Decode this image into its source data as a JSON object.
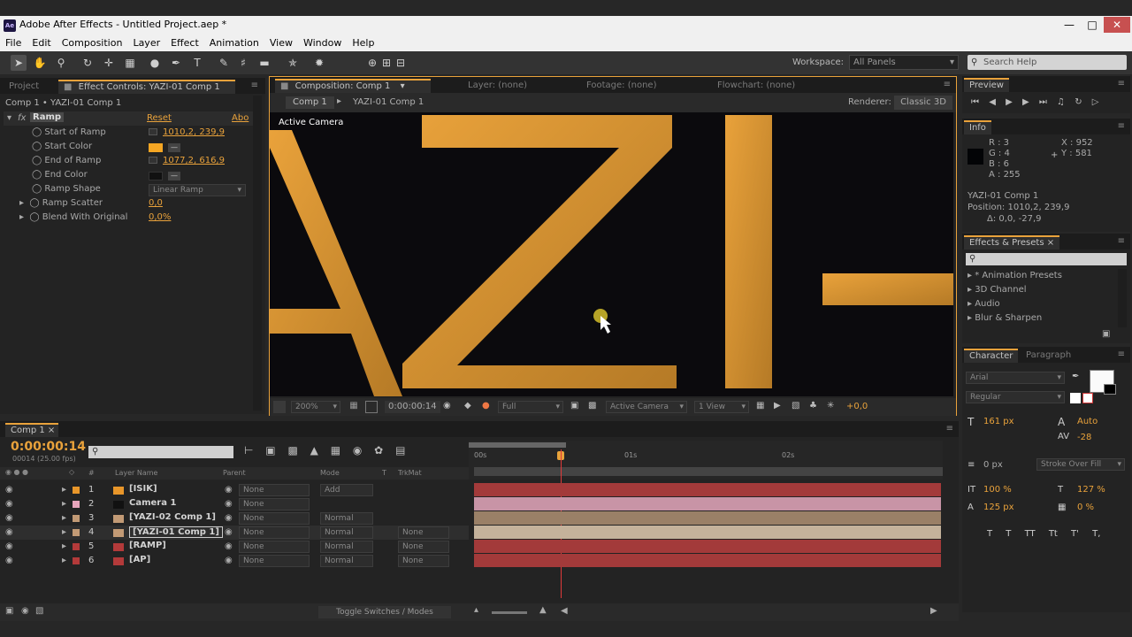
{
  "window": {
    "title": "Adobe After Effects - Untitled Project.aep *",
    "logo": "Ae"
  },
  "menu": [
    "File",
    "Edit",
    "Composition",
    "Layer",
    "Effect",
    "Animation",
    "View",
    "Window",
    "Help"
  ],
  "toolbar": {
    "workspace_label": "Workspace:",
    "workspace_value": "All Panels",
    "search_placeholder": "Search Help"
  },
  "project_panel": {
    "tab_project": "Project",
    "tab_effect": "Effect Controls: YAZI-01 Comp 1",
    "breadcrumb": "Comp 1 • YAZI-01 Comp 1",
    "effect_name": "Ramp",
    "reset": "Reset",
    "about": "Abo",
    "props": [
      {
        "name": "Start of Ramp",
        "value": "1010,2, 239,9"
      },
      {
        "name": "Start Color",
        "value": ""
      },
      {
        "name": "End of Ramp",
        "value": "1077,2, 616,9"
      },
      {
        "name": "End Color",
        "value": ""
      },
      {
        "name": "Ramp Shape",
        "value": "Linear Ramp"
      },
      {
        "name": "Ramp Scatter",
        "value": "0,0"
      },
      {
        "name": "Blend With Original",
        "value": "0,0%"
      }
    ],
    "start_color": "#f5a623",
    "end_color": "#111111"
  },
  "comp_panel": {
    "tab_comp": "Composition: Comp 1",
    "tab_layer": "Layer: (none)",
    "tab_footage": "Footage: (none)",
    "tab_flowchart": "Flowchart: (none)",
    "comp_name": "Comp 1",
    "sub_comp": "YAZI-01 Comp 1",
    "renderer_label": "Renderer:",
    "renderer_value": "Classic 3D",
    "active_camera": "Active Camera",
    "zoom": "200%",
    "timecode": "0:00:00:14",
    "resolution": "Full",
    "view": "Active Camera",
    "views": "1 View",
    "exposure": "+0,0"
  },
  "preview": {
    "tab": "Preview"
  },
  "info": {
    "tab": "Info",
    "r": "R : 3",
    "g": "G : 4",
    "b": "B : 6",
    "a": "A : 255",
    "x": "X : 952",
    "y": "Y : 581",
    "line1": "YAZI-01 Comp 1",
    "line2": "Position: 1010,2, 239,9",
    "line3": "Δ: 0,0, -27,9"
  },
  "effects_presets": {
    "tab": "Effects & Presets",
    "items": [
      "* Animation Presets",
      "3D Channel",
      "Audio",
      "Blur & Sharpen"
    ]
  },
  "character": {
    "tab": "Character",
    "tab2": "Paragraph",
    "font": "Arial",
    "style": "Regular",
    "size": "161 px",
    "leading": "Auto",
    "tracking": "-28",
    "stroke_width": "0 px",
    "stroke_mode": "Stroke Over Fill",
    "vscale": "100 %",
    "hscale": "127 %",
    "baseline": "125 px",
    "tsume": "0 %",
    "styles": [
      "T",
      "T",
      "TT",
      "Tt",
      "T'",
      "T,"
    ]
  },
  "timeline": {
    "tab": "Comp 1",
    "timecode": "0:00:00:14",
    "fps": "00014 (25.00 fps)",
    "col_layer": "Layer Name",
    "col_parent": "Parent",
    "col_mode": "Mode",
    "col_t": "T",
    "col_trkmat": "TrkMat",
    "ruler": [
      "00s",
      "01s",
      "02s"
    ],
    "toggle": "Toggle Switches / Modes",
    "layers": [
      {
        "num": "1",
        "name": "[ISIK]",
        "color": "#e8962a",
        "parent": "None",
        "mode": "Add",
        "trk": "",
        "bar": "#a33a3a"
      },
      {
        "num": "2",
        "name": "Camera 1",
        "color": "#e7a5bc",
        "parent": "None",
        "mode": "",
        "trk": "",
        "bar": "#c894a6"
      },
      {
        "num": "3",
        "name": "[YAZI-02 Comp 1]",
        "color": "#c29a75",
        "parent": "None",
        "mode": "Normal",
        "trk": "",
        "bar": "#9a8067"
      },
      {
        "num": "4",
        "name": "[YAZI-01 Comp 1]",
        "color": "#c29a75",
        "parent": "None",
        "mode": "Normal",
        "trk": "None",
        "bar": "#c4b29b"
      },
      {
        "num": "5",
        "name": "[RAMP]",
        "color": "#b33a3a",
        "parent": "None",
        "mode": "Normal",
        "trk": "None",
        "bar": "#a33a3a"
      },
      {
        "num": "6",
        "name": "[AP]",
        "color": "#b33a3a",
        "parent": "None",
        "mode": "Normal",
        "trk": "None",
        "bar": "#a33a3a"
      }
    ]
  }
}
